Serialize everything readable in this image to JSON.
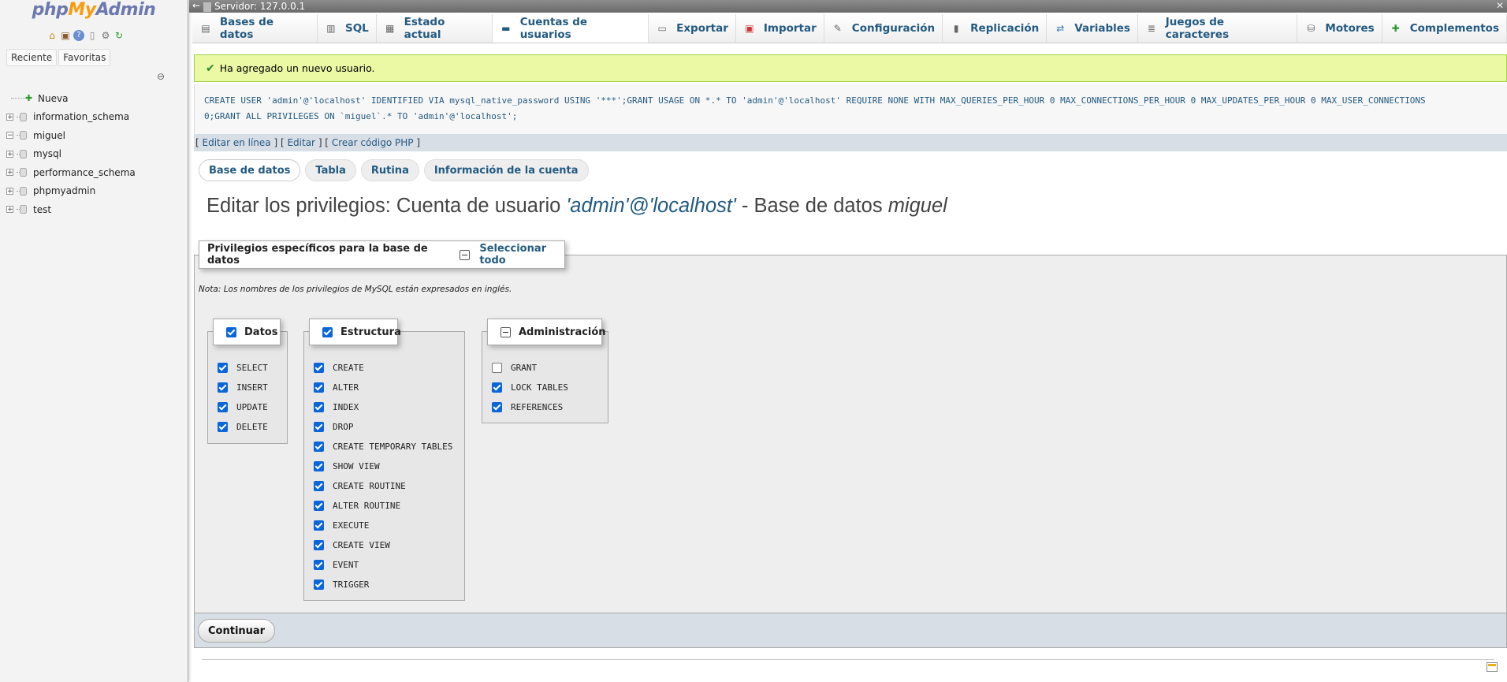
{
  "logo": {
    "php": "php",
    "my": "My",
    "admin": "Admin"
  },
  "left_panel": {
    "icons": [
      "home-icon",
      "logout-icon",
      "help-icon",
      "docs-icon",
      "settings-icon",
      "reload-icon"
    ],
    "tabs": [
      "Reciente",
      "Favoritas"
    ],
    "tree": [
      {
        "name": "Nueva",
        "type": "new"
      },
      {
        "name": "information_schema",
        "type": "db"
      },
      {
        "name": "miguel",
        "type": "db",
        "expanded": true
      },
      {
        "name": "mysql",
        "type": "db"
      },
      {
        "name": "performance_schema",
        "type": "db"
      },
      {
        "name": "phpmyadmin",
        "type": "db"
      },
      {
        "name": "test",
        "type": "db"
      }
    ]
  },
  "server_bar": {
    "label": "Servidor: 127.0.0.1"
  },
  "top_tabs": [
    {
      "label": "Bases de datos",
      "icon": "database-icon"
    },
    {
      "label": "SQL",
      "icon": "sql-icon"
    },
    {
      "label": "Estado actual",
      "icon": "status-icon"
    },
    {
      "label": "Cuentas de usuarios",
      "icon": "users-icon",
      "active": true
    },
    {
      "label": "Exportar",
      "icon": "export-icon"
    },
    {
      "label": "Importar",
      "icon": "import-icon"
    },
    {
      "label": "Configuración",
      "icon": "wrench-icon"
    },
    {
      "label": "Replicación",
      "icon": "replication-icon"
    },
    {
      "label": "Variables",
      "icon": "variables-icon"
    },
    {
      "label": "Juegos de caracteres",
      "icon": "charset-icon"
    },
    {
      "label": "Motores",
      "icon": "engines-icon"
    },
    {
      "label": "Complementos",
      "icon": "plugins-icon"
    }
  ],
  "success": {
    "message": "Ha agregado un nuevo usuario."
  },
  "sql": {
    "line1": "CREATE USER 'admin'@'localhost' IDENTIFIED VIA mysql_native_password USING '***';GRANT USAGE ON *.* TO 'admin'@'localhost' REQUIRE NONE WITH MAX_QUERIES_PER_HOUR 0 MAX_CONNECTIONS_PER_HOUR 0 MAX_UPDATES_PER_HOUR 0 MAX_USER_CONNECTIONS",
    "line2": "0;GRANT ALL PRIVILEGES ON `miguel`.* TO 'admin'@'localhost';"
  },
  "edit_links": {
    "inline": "Editar en línea",
    "edit": "Editar",
    "php": "Crear código PHP"
  },
  "sub_tabs": [
    {
      "label": "Base de datos",
      "active": true
    },
    {
      "label": "Tabla"
    },
    {
      "label": "Rutina"
    },
    {
      "label": "Información de la cuenta"
    }
  ],
  "heading": {
    "prefix": "Editar los privilegios: Cuenta de usuario ",
    "user": "'admin'@'localhost'",
    "middle": " - Base de datos ",
    "db": "miguel"
  },
  "fieldset": {
    "legend": "Privilegios específicos para la base de datos",
    "select_all": "Seleccionar todo",
    "note": "Nota: Los nombres de los privilegios de MySQL están expresados en inglés."
  },
  "groups": {
    "datos": {
      "label": "Datos",
      "checked": true,
      "items": [
        {
          "name": "SELECT",
          "checked": true
        },
        {
          "name": "INSERT",
          "checked": true
        },
        {
          "name": "UPDATE",
          "checked": true
        },
        {
          "name": "DELETE",
          "checked": true
        }
      ]
    },
    "estructura": {
      "label": "Estructura",
      "checked": true,
      "items": [
        {
          "name": "CREATE",
          "checked": true
        },
        {
          "name": "ALTER",
          "checked": true
        },
        {
          "name": "INDEX",
          "checked": true
        },
        {
          "name": "DROP",
          "checked": true
        },
        {
          "name": "CREATE TEMPORARY TABLES",
          "checked": true
        },
        {
          "name": "SHOW VIEW",
          "checked": true
        },
        {
          "name": "CREATE ROUTINE",
          "checked": true
        },
        {
          "name": "ALTER ROUTINE",
          "checked": true
        },
        {
          "name": "EXECUTE",
          "checked": true
        },
        {
          "name": "CREATE VIEW",
          "checked": true
        },
        {
          "name": "EVENT",
          "checked": true
        },
        {
          "name": "TRIGGER",
          "checked": true
        }
      ]
    },
    "administracion": {
      "label": "Administración",
      "checked": "partial",
      "items": [
        {
          "name": "GRANT",
          "checked": false
        },
        {
          "name": "LOCK TABLES",
          "checked": true
        },
        {
          "name": "REFERENCES",
          "checked": true
        }
      ]
    }
  },
  "continue_button": "Continuar",
  "colors": {
    "accent": "#235a81",
    "success_bg": "#ebf8a4",
    "checkbox": "#0a66d8"
  }
}
